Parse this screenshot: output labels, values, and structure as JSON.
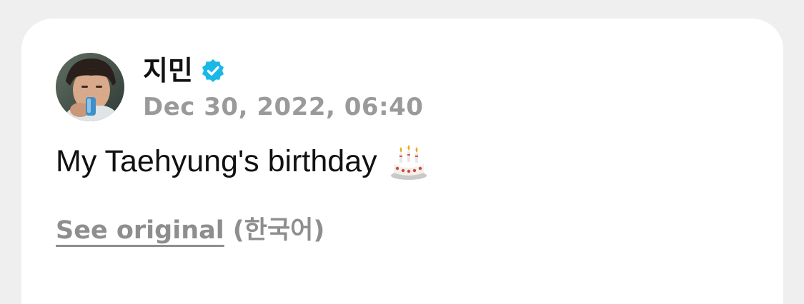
{
  "post": {
    "author": {
      "name": "지민",
      "verified": true,
      "verified_color": "#1ab8e6",
      "avatar_icon": "profile-photo"
    },
    "timestamp": "Dec 30, 2022, 06:40",
    "text": "My Taehyung's birthday",
    "emoji": "cake-with-candles-icon",
    "translation": {
      "see_original_label": "See original",
      "language_label": "(한국어)"
    }
  },
  "colors": {
    "background": "#efefef",
    "card": "#ffffff",
    "primary_text": "#111111",
    "secondary_text": "#9a9a9a"
  }
}
